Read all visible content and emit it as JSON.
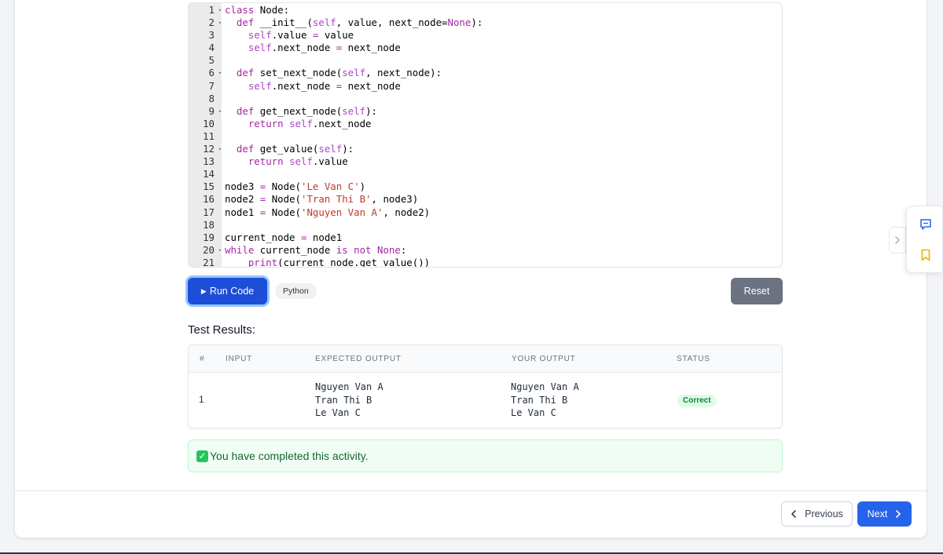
{
  "editor": {
    "lines": [
      {
        "n": "1",
        "fold": true,
        "html": "<span class=\"kw\">class</span> Node:"
      },
      {
        "n": "2",
        "fold": true,
        "html": "  <span class=\"kw\">def</span> __init__(<span class=\"slf\">self</span>, value, next_node=<span class=\"kw\">None</span>):"
      },
      {
        "n": "3",
        "fold": false,
        "html": "    <span class=\"slf\">self</span>.value <span class=\"op\">=</span> value"
      },
      {
        "n": "4",
        "fold": false,
        "html": "    <span class=\"slf\">self</span>.next_node <span class=\"op\">=</span> next_node"
      },
      {
        "n": "5",
        "fold": false,
        "html": ""
      },
      {
        "n": "6",
        "fold": true,
        "html": "  <span class=\"kw\">def</span> set_next_node(<span class=\"slf\">self</span>, next_node):"
      },
      {
        "n": "7",
        "fold": false,
        "html": "    <span class=\"slf\">self</span>.next_node <span class=\"op\">=</span> next_node"
      },
      {
        "n": "8",
        "fold": false,
        "html": ""
      },
      {
        "n": "9",
        "fold": true,
        "html": "  <span class=\"kw\">def</span> get_next_node(<span class=\"slf\">self</span>):"
      },
      {
        "n": "10",
        "fold": false,
        "html": "    <span class=\"kw\">return</span> <span class=\"slf\">self</span>.next_node"
      },
      {
        "n": "11",
        "fold": false,
        "html": ""
      },
      {
        "n": "12",
        "fold": true,
        "html": "  <span class=\"kw\">def</span> get_value(<span class=\"slf\">self</span>):"
      },
      {
        "n": "13",
        "fold": false,
        "html": "    <span class=\"kw\">return</span> <span class=\"slf\">self</span>.value"
      },
      {
        "n": "14",
        "fold": false,
        "html": ""
      },
      {
        "n": "15",
        "fold": false,
        "html": "node3 <span class=\"op\">=</span> Node(<span class=\"str\">'Le Van C'</span>)"
      },
      {
        "n": "16",
        "fold": false,
        "html": "node2 <span class=\"op\">=</span> Node(<span class=\"str\">'Tran Thi B'</span>, node3)"
      },
      {
        "n": "17",
        "fold": false,
        "html": "node1 <span class=\"op\">=</span> Node(<span class=\"str\">'Nguyen Van A'</span>, node2)"
      },
      {
        "n": "18",
        "fold": false,
        "html": ""
      },
      {
        "n": "19",
        "fold": false,
        "html": "current_node <span class=\"op\">=</span> node1"
      },
      {
        "n": "20",
        "fold": true,
        "html": "<span class=\"kw\">while</span> current_node <span class=\"kw\">is</span> <span class=\"kw\">not</span> <span class=\"kw\">None</span>:"
      },
      {
        "n": "21",
        "fold": false,
        "html": "    <span class=\"kw\">print</span>(current_node.get_value())"
      }
    ]
  },
  "toolbar": {
    "run_label": "Run Code",
    "run_glyph": "▶",
    "language": "Python",
    "reset_label": "Reset"
  },
  "results": {
    "title": "Test Results:",
    "headers": {
      "num": "#",
      "input": "Input",
      "expected": "Expected Output",
      "yours": "Your Output",
      "status": "Status"
    },
    "rows": [
      {
        "num": "1",
        "input": "",
        "expected": "Nguyen Van A\nTran Thi B\nLe Van C",
        "yours": "Nguyen Van A\nTran Thi B\nLe Van C",
        "status": "Correct"
      }
    ]
  },
  "completion": {
    "message": "You have completed this activity.",
    "icon": "check-square-icon"
  },
  "nav": {
    "previous_label": "Previous",
    "next_label": "Next"
  },
  "colors": {
    "primary": "#2563eb",
    "run_button": "#1d4ed8",
    "reset_button": "#6b7280",
    "success_bg": "#f0fdf4",
    "success_text": "#166534"
  }
}
